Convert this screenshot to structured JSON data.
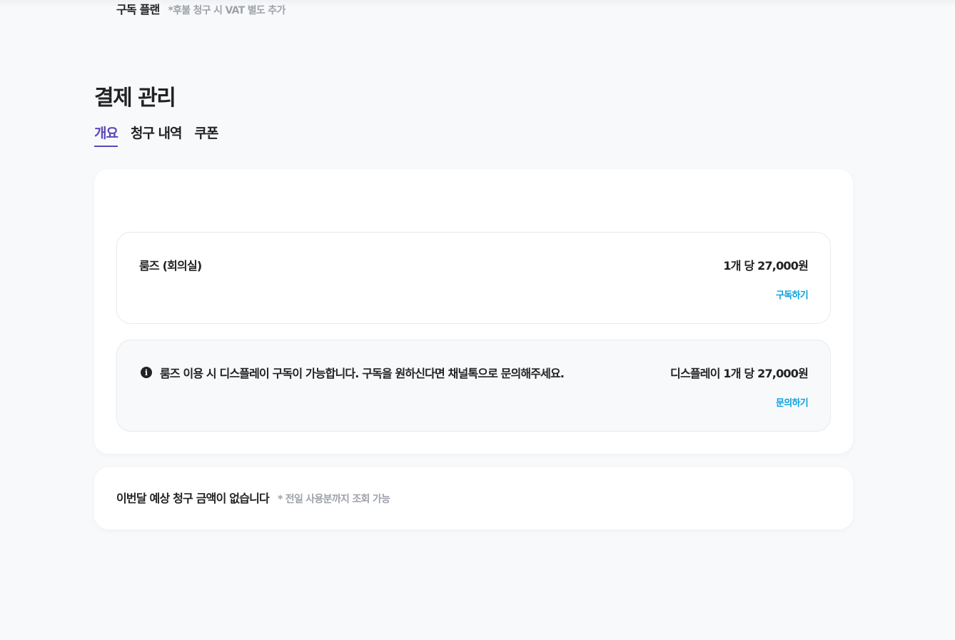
{
  "page": {
    "title": "결제 관리"
  },
  "tabs": [
    {
      "label": "개요",
      "active": true
    },
    {
      "label": "청구 내역",
      "active": false
    },
    {
      "label": "쿠폰",
      "active": false
    }
  ],
  "subscription": {
    "heading": "구독 플랜",
    "note": "*후불 청구 시 VAT 별도 추가",
    "plan": {
      "name": "룸즈 (회의실)",
      "price": "1개 당 27,000원",
      "action_label": "구독하기"
    },
    "info": {
      "icon": "info-circle-icon",
      "message": "룸즈 이용 시 디스플레이 구독이 가능합니다. 구독을 원하신다면 채널톡으로 문의해주세요.",
      "price": "디스플레이 1개 당 27,000원",
      "action_label": "문의하기"
    }
  },
  "estimate": {
    "heading": "이번달 예상 청구 금액이 없습니다",
    "note": "* 전일 사용분까지 조회 가능"
  },
  "colors": {
    "background": "#f8f9fb",
    "card": "#ffffff",
    "accent_tab": "#5b46b8",
    "link": "#0aa0de",
    "muted_text": "#9ea2a8",
    "text": "#222222"
  }
}
